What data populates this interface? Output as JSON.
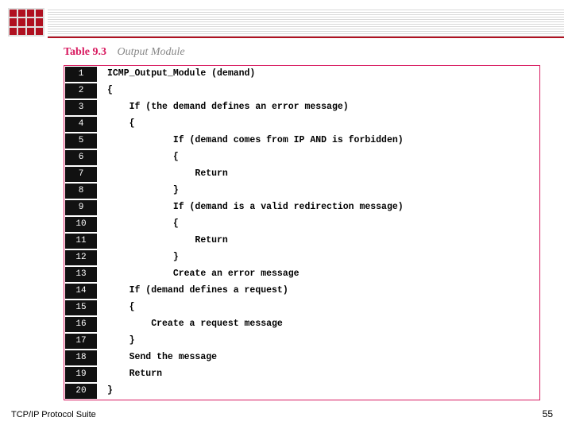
{
  "caption": {
    "number": "Table 9.3",
    "title": "Output Module"
  },
  "code": {
    "lines": [
      {
        "n": "1",
        "indent": 0,
        "text": "ICMP_Output_Module (demand)"
      },
      {
        "n": "2",
        "indent": 0,
        "text": "{"
      },
      {
        "n": "3",
        "indent": 1,
        "text": "If (the demand defines an error message)"
      },
      {
        "n": "4",
        "indent": 1,
        "text": "{"
      },
      {
        "n": "5",
        "indent": 3,
        "text": "If (demand comes from IP AND is forbidden)"
      },
      {
        "n": "6",
        "indent": 3,
        "text": "{"
      },
      {
        "n": "7",
        "indent": 4,
        "text": "Return"
      },
      {
        "n": "8",
        "indent": 3,
        "text": "}"
      },
      {
        "n": "9",
        "indent": 3,
        "text": "If (demand is a valid redirection message)"
      },
      {
        "n": "10",
        "indent": 3,
        "text": "{"
      },
      {
        "n": "11",
        "indent": 4,
        "text": "Return"
      },
      {
        "n": "12",
        "indent": 3,
        "text": "}"
      },
      {
        "n": "13",
        "indent": 3,
        "text": "Create an error message"
      },
      {
        "n": "14",
        "indent": 1,
        "text": "If (demand defines a request)"
      },
      {
        "n": "15",
        "indent": 1,
        "text": "{"
      },
      {
        "n": "16",
        "indent": 2,
        "text": "Create a request message"
      },
      {
        "n": "17",
        "indent": 1,
        "text": "}"
      },
      {
        "n": "18",
        "indent": 1,
        "text": "Send the message"
      },
      {
        "n": "19",
        "indent": 1,
        "text": "Return"
      },
      {
        "n": "20",
        "indent": 0,
        "text": "}"
      }
    ]
  },
  "footer": {
    "left": "TCP/IP Protocol Suite",
    "right": "55"
  }
}
